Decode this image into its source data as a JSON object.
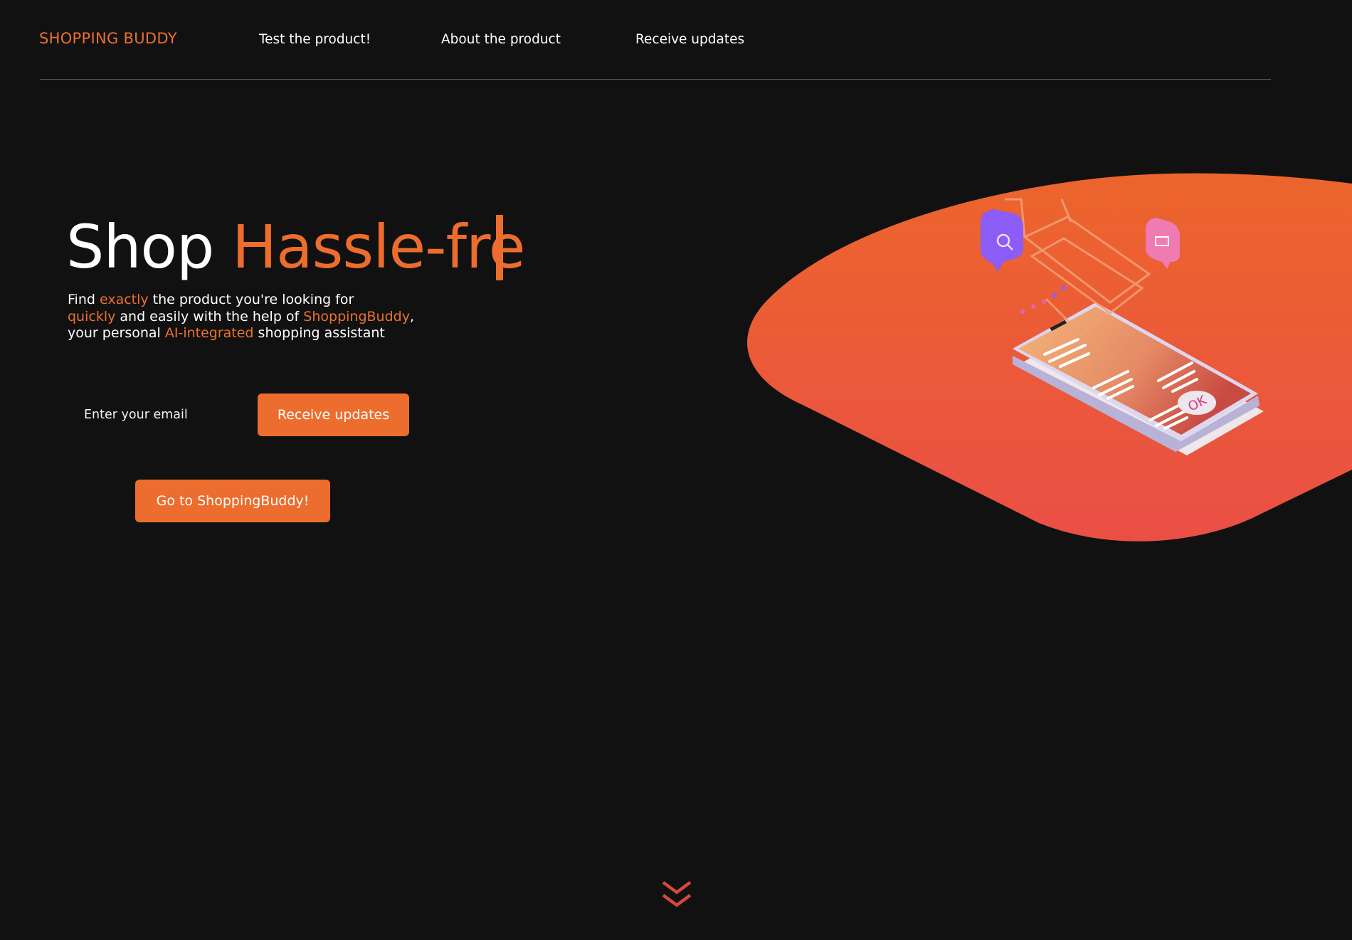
{
  "header": {
    "logo": "SHOPPING BUDDY",
    "nav": [
      {
        "label": "Test the product!"
      },
      {
        "label": "About the product"
      },
      {
        "label": "Receive updates"
      }
    ]
  },
  "hero": {
    "headline_plain": "Shop ",
    "headline_accent": "Hassle-fre",
    "description": {
      "l1a": "Find ",
      "l1b": "exactly",
      "l1c": " the product you're looking for",
      "l2a": "quickly",
      "l2b": " and easily with the help of ",
      "l2c": "ShoppingBuddy",
      "l2d": ",",
      "l3a": "your personal ",
      "l3b": "AI-integrated",
      "l3c": " shopping assistant"
    },
    "email_placeholder": "Enter your email",
    "email_value": "",
    "receive_button": "Receive updates",
    "go_button": "Go to ShoppingBuddy!",
    "illustration_badge": "OK"
  },
  "colors": {
    "background": "#111111",
    "accent": "#ec6d2d",
    "blob_top": "#ec652c",
    "blob_bottom": "#ea4f45"
  },
  "icons": [
    "search-bubble-icon",
    "basket-bubble-icon",
    "shopping-cart-icon",
    "smartphone-icon",
    "scroll-down-chevron-icon"
  ]
}
